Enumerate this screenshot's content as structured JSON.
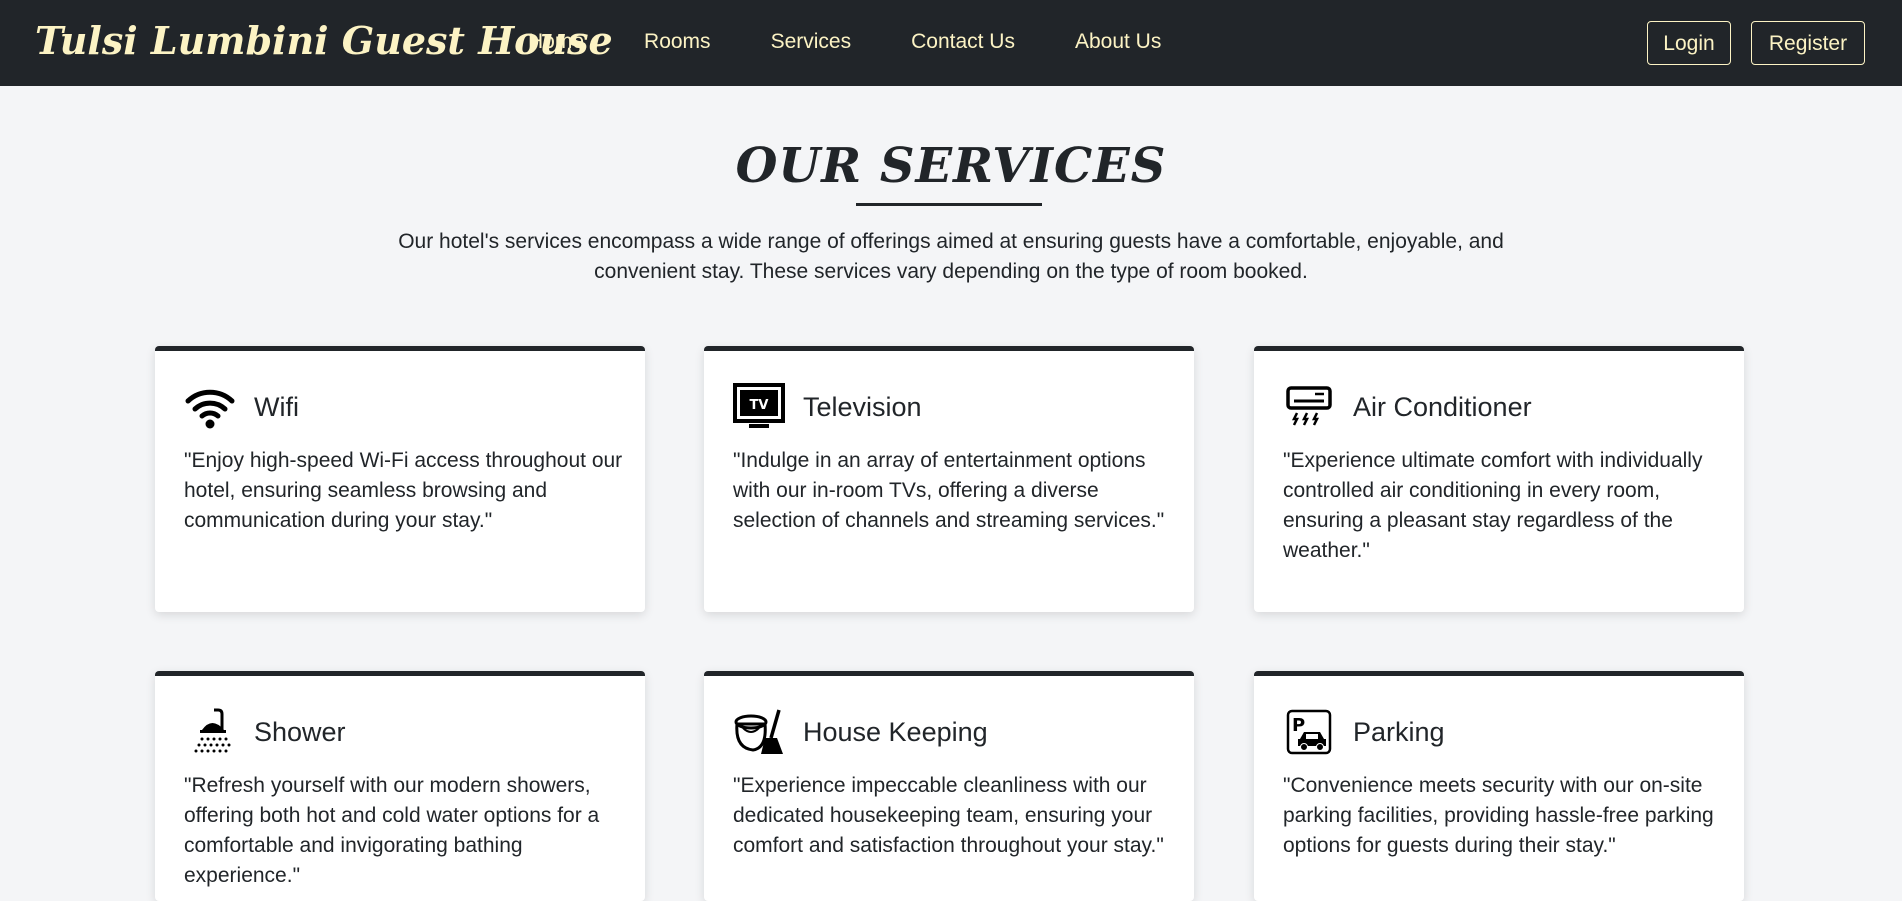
{
  "navbar": {
    "brand": "Tulsi Lumbini Guest House",
    "links": [
      "Home",
      "Rooms",
      "Services",
      "Contact Us",
      "About Us"
    ],
    "login_label": "Login",
    "register_label": "Register"
  },
  "main": {
    "title": "OUR SERVICES",
    "intro": "Our hotel's services encompass a wide range of offerings aimed at ensuring guests have a comfortable, enjoyable, and convenient stay. These services vary depending on the type of room booked."
  },
  "services": [
    {
      "title": "Wifi",
      "icon": "wifi-icon",
      "text": "\"Enjoy high-speed Wi-Fi access throughout our hotel, ensuring seamless browsing and communication during your stay.\""
    },
    {
      "title": "Television",
      "icon": "tv-icon",
      "text": "\"Indulge in an array of entertainment options with our in-room TVs, offering a diverse selection of channels and streaming services.\""
    },
    {
      "title": "Air Conditioner",
      "icon": "air-conditioner-icon",
      "text": "\"Experience ultimate comfort with individually controlled air conditioning in every room, ensuring a pleasant stay regardless of the weather.\""
    },
    {
      "title": "Shower",
      "icon": "shower-icon",
      "text": "\"Refresh yourself with our modern showers, offering both hot and cold water options for a comfortable and invigorating bathing experience.\""
    },
    {
      "title": "House Keeping",
      "icon": "housekeeping-icon",
      "text": "\"Experience impeccable cleanliness with our dedicated housekeeping team, ensuring your comfort and satisfaction throughout your stay.\""
    },
    {
      "title": "Parking",
      "icon": "parking-icon",
      "text": "\"Convenience meets security with our on-site parking facilities, providing hassle-free parking options for guests during their stay.\""
    }
  ],
  "colors": {
    "navbar_bg": "#212529",
    "nav_text": "#fcf3c4",
    "page_bg": "#f4f5f7",
    "card_bg": "#ffffff"
  }
}
